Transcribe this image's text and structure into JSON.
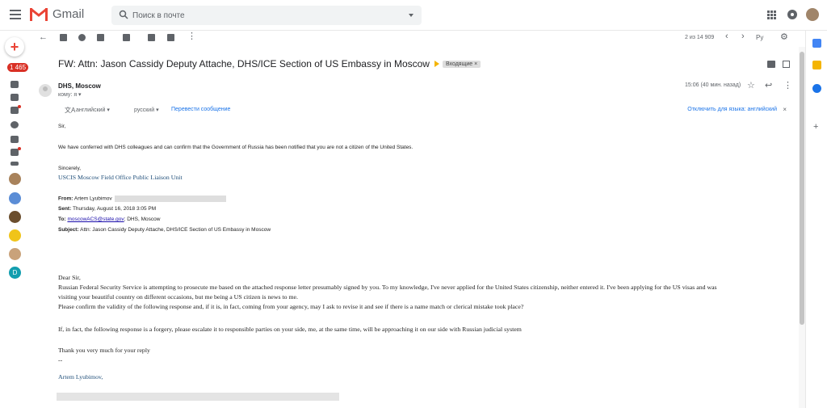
{
  "app": {
    "name": "Gmail"
  },
  "search": {
    "placeholder": "Поиск в почте"
  },
  "sidebar": {
    "inbox_count": "1 465",
    "contact_initial": "D"
  },
  "toolbar": {
    "pager": "2 из 14 909",
    "language": "Ру"
  },
  "email": {
    "subject": "FW: Attn: Jason Cassidy Deputy Attache, DHS/ICE Section of US Embassy in Moscow",
    "label": "Входящие",
    "label_close": "×",
    "sender": "DHS, Moscow",
    "to_me": "кому: я",
    "time": "15:06 (40 мин. назад)",
    "translate": {
      "from": "английский",
      "to": "русский",
      "translate_button": "Перевести сообщение",
      "disable": "Отключить для языка: английский",
      "close": "×"
    },
    "body": {
      "greeting": "Sir,",
      "para1": "We have conferred with DHS colleagues and can confirm that the Government of Russia has been notified that you are not a citizen  of the United States.",
      "sincerely": "Sincerely,",
      "unit": "USCIS Moscow Field Office Public Liaison Unit",
      "fwd": {
        "from_label": "From:",
        "from_value": "Artem Lyubimov",
        "sent_label": "Sent:",
        "sent_value": "Thursday, August 16, 2018 3:05 PM",
        "to_label": "To:",
        "to_link": "moscowACS@state.gov",
        "to_rest": "; DHS, Moscow",
        "subject_label": "Subject:",
        "subject_value": "Attn: Jason Cassidy Deputy Attache, DHS/ICE Section of US Embassy in Moscow"
      },
      "dear": "Dear Sir,",
      "p2_line1": "Russian Federal Security Service is attempting to prosecute me based on the attached response letter presumably signed by you. To my knowledge, I've never applied for the United States citizenship,  neither entered it. I've been applying for the US visas and was",
      "p2_line2": "visiting your beautiful country on different occasions, but me being a US citizen is news to me.",
      "p2_line3": "Please confirm the validity of the following response and, if it is, in fact, coming from your agency, may I ask to revise it and see if there is a name match or clerical mistake took place?",
      "p3": "If, in fact, the following response is a forgery, please escalate it to responsible parties on your side, me, at the same time, will be approaching it on our side with Russian judicial system",
      "thanks": "Thank you very much for your reply",
      "dashes": "--",
      "signature": "Artem Lyubimov,"
    }
  },
  "colors": {
    "accent": "#1a73e8",
    "badge": "#d93025",
    "important": "#f4b400"
  }
}
